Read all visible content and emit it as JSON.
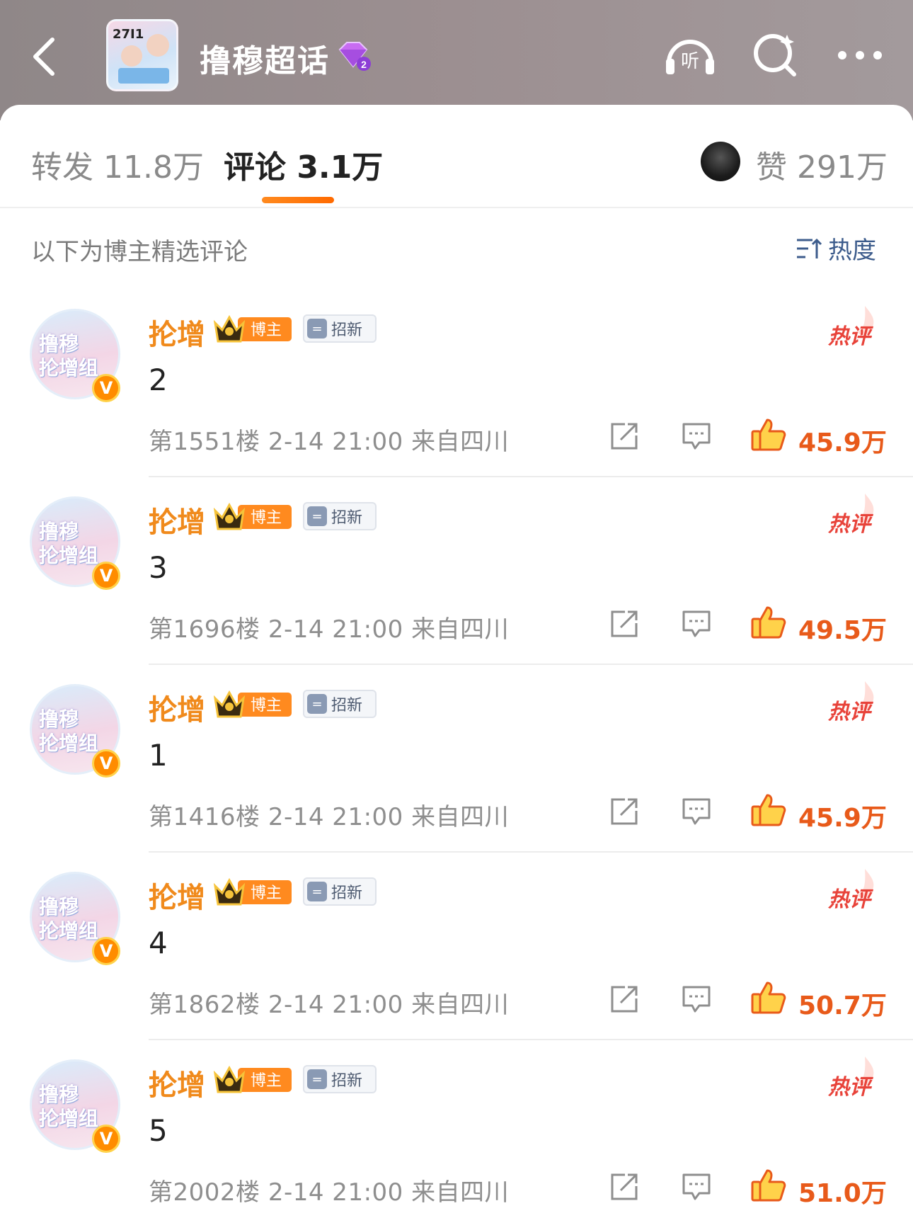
{
  "header": {
    "topic_title": "撸穆超话",
    "thumb_label": "27I1",
    "level_badge": "2"
  },
  "tabs": {
    "repost_label": "转发 11.8万",
    "comment_label": "评论 3.1万",
    "likes_label": "赞 291万"
  },
  "section": {
    "label": "以下为博主精选评论",
    "sort_label": "热度"
  },
  "badges": {
    "crown_text": "博主",
    "tag_icon": "=",
    "tag_text": "招新",
    "hot_text": "热评",
    "avatar_text_1": "撸穆",
    "avatar_text_2": "抡增组",
    "verify": "V"
  },
  "colors": {
    "name": "#f08a1c",
    "like": "#e85a1a",
    "hot": "#e8433a",
    "tab_underline": "#ff7a10"
  },
  "comments": [
    {
      "name": "抡增",
      "text": "2",
      "meta": "第1551楼 2-14 21:00 来自四川",
      "likes": "45.9万"
    },
    {
      "name": "抡增",
      "text": "3",
      "meta": "第1696楼 2-14 21:00 来自四川",
      "likes": "49.5万"
    },
    {
      "name": "抡增",
      "text": "1",
      "meta": "第1416楼 2-14 21:00 来自四川",
      "likes": "45.9万"
    },
    {
      "name": "抡增",
      "text": "4",
      "meta": "第1862楼 2-14 21:00 来自四川",
      "likes": "50.7万"
    },
    {
      "name": "抡增",
      "text": "5",
      "meta": "第2002楼 2-14 21:00 来自四川",
      "likes": "51.0万"
    }
  ]
}
